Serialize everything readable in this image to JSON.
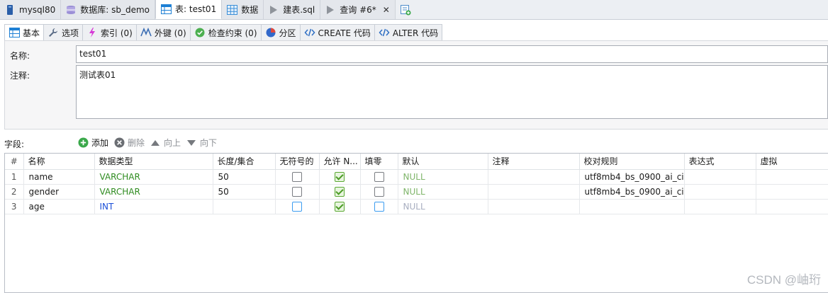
{
  "doc_tabs": [
    {
      "label": "mysql80",
      "icon": "database-server-icon"
    },
    {
      "label": "数据库: sb_demo",
      "icon": "database-icon"
    },
    {
      "label": "表: test01",
      "icon": "table-icon",
      "active": true
    },
    {
      "label": "数据",
      "icon": "data-grid-icon"
    },
    {
      "label": "建表.sql",
      "icon": "play-icon"
    },
    {
      "label": "查询 #6*",
      "icon": "play-icon",
      "close": "✕"
    }
  ],
  "design_tabs": [
    {
      "label": "基本",
      "icon": "table-basic-icon",
      "active": true
    },
    {
      "label": "选项",
      "icon": "wrench-icon"
    },
    {
      "label": "索引 (0)",
      "icon": "lightning-icon"
    },
    {
      "label": "外键 (0)",
      "icon": "foreign-key-icon"
    },
    {
      "label": "检查约束 (0)",
      "icon": "check-circle-icon"
    },
    {
      "label": "分区",
      "icon": "partition-icon"
    },
    {
      "label": "CREATE 代码",
      "icon": "code-icon"
    },
    {
      "label": "ALTER 代码",
      "icon": "code-icon"
    }
  ],
  "props": {
    "name_label": "名称:",
    "name_value": "test01",
    "comment_label": "注释:",
    "comment_value": "测试表01"
  },
  "fields_toolbar": {
    "label": "字段:",
    "add": "添加",
    "delete": "删除",
    "up": "向上",
    "down": "向下"
  },
  "columns": [
    "#",
    "名称",
    "数据类型",
    "长度/集合",
    "无符号的",
    "允许 N...",
    "填零",
    "默认",
    "注释",
    "校对规则",
    "表达式",
    "虚拟"
  ],
  "rows": [
    {
      "num": "1",
      "name": "name",
      "type": "VARCHAR",
      "length": "50",
      "unsigned": false,
      "allow_null": true,
      "zerofill": false,
      "default": "NULL",
      "comment": "",
      "collation": "utf8mb4_bs_0900_ai_ci",
      "expression": "",
      "virtual": ""
    },
    {
      "num": "2",
      "name": "gender",
      "type": "VARCHAR",
      "length": "50",
      "unsigned": false,
      "allow_null": true,
      "zerofill": false,
      "default": "NULL",
      "comment": "",
      "collation": "utf8mb4_bs_0900_ai_ci",
      "expression": "",
      "virtual": ""
    },
    {
      "num": "3",
      "name": "age",
      "type": "INT",
      "length": "",
      "unsigned": false,
      "allow_null": true,
      "zerofill": false,
      "default": "NULL",
      "comment": "",
      "collation": "",
      "expression": "",
      "virtual": ""
    }
  ],
  "watermark": "CSDN @岫珩",
  "colors": {
    "varchar_type": "#2e8b1f",
    "int_type": "#1b4fd8",
    "null_default": "#7fb56a",
    "checkbox_checked": "#5aa832"
  }
}
